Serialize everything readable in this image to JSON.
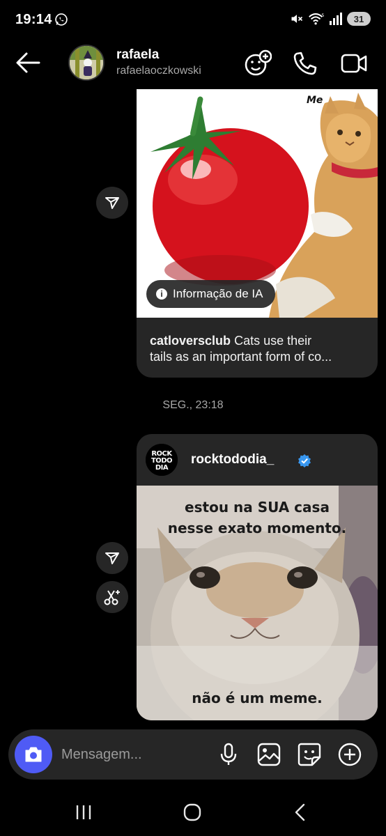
{
  "status_bar": {
    "time": "19:14",
    "battery": "31"
  },
  "header": {
    "name": "rafaela",
    "handle": "rafaelaoczkowski"
  },
  "messages": {
    "post1": {
      "image_label": "Me",
      "ai_badge": "Informação de IA",
      "caption_user": "catloversclub",
      "caption_text_line1": " Cats use their",
      "caption_text_line2": "tails as an important form of co..."
    },
    "timestamp": "SEG., 23:18",
    "post2": {
      "username": "rocktododia_",
      "logo_text": "ROCK TODO DIA",
      "meme_top_line1": "estou na SUA casa",
      "meme_top_line2": "nesse exato momento.",
      "meme_bottom": "não é um meme."
    }
  },
  "composer": {
    "placeholder": "Mensagem..."
  },
  "colors": {
    "background": "#000000",
    "bubble": "#262626",
    "accent_camera": "#4f5bf5",
    "verified": "#3897f0"
  },
  "icons": [
    "whatsapp-icon",
    "mute-icon",
    "wifi-icon",
    "signal-icon",
    "back-arrow-icon",
    "sticker-plus-icon",
    "phone-icon",
    "video-icon",
    "share-icon",
    "cut-icon",
    "camera-icon",
    "microphone-icon",
    "gallery-icon",
    "sticker-icon",
    "add-icon",
    "recents-icon",
    "home-icon",
    "back-nav-icon"
  ]
}
